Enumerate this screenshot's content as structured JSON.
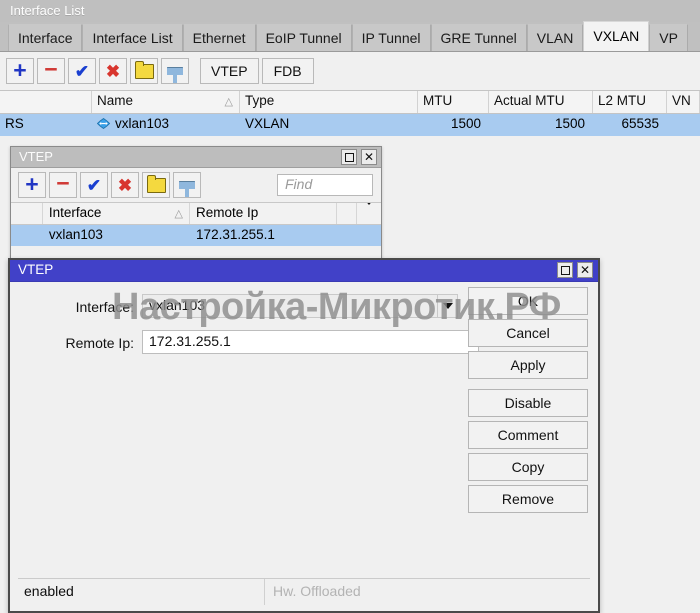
{
  "main_window": {
    "title": "Interface List",
    "tabs": [
      {
        "label": "Interface",
        "active": false
      },
      {
        "label": "Interface List",
        "active": false
      },
      {
        "label": "Ethernet",
        "active": false
      },
      {
        "label": "EoIP Tunnel",
        "active": false
      },
      {
        "label": "IP Tunnel",
        "active": false
      },
      {
        "label": "GRE Tunnel",
        "active": false
      },
      {
        "label": "VLAN",
        "active": false
      },
      {
        "label": "VXLAN",
        "active": true
      },
      {
        "label": "VP",
        "active": false
      }
    ],
    "toolbar": {
      "add_icon": "plus-icon",
      "remove_icon": "minus-icon",
      "enable_icon": "check-icon",
      "disable_icon": "cross-icon",
      "comment_icon": "folder-icon",
      "filter_icon": "filter-icon",
      "vtep_label": "VTEP",
      "fdb_label": "FDB"
    },
    "table": {
      "columns": [
        "",
        "Name",
        "Type",
        "MTU",
        "Actual MTU",
        "L2 MTU",
        "VN"
      ],
      "sort_indicator_column": "Name",
      "rows": [
        {
          "flags": "RS",
          "name": "vxlan103",
          "name_icon": "vxlan-interface-icon",
          "type": "VXLAN",
          "mtu": "1500",
          "actual_mtu": "1500",
          "l2_mtu": "65535",
          "vni": ""
        }
      ]
    }
  },
  "vtep_list_window": {
    "title": "VTEP",
    "maximize_icon": "maximize-icon",
    "close_icon": "close-icon",
    "toolbar": {
      "add_icon": "plus-icon",
      "remove_icon": "minus-icon",
      "enable_icon": "check-icon",
      "disable_icon": "cross-icon",
      "comment_icon": "folder-icon",
      "filter_icon": "filter-icon"
    },
    "find_placeholder": "Find",
    "find_value": "",
    "table": {
      "columns": [
        "",
        "Interface",
        "Remote Ip",
        "",
        ""
      ],
      "column_menu_icon": "chevron-down-icon",
      "rows": [
        {
          "flags": "",
          "interface": "vxlan103",
          "remote_ip": "172.31.255.1"
        }
      ]
    }
  },
  "vtep_dialog": {
    "title": "VTEP",
    "maximize_icon": "maximize-icon",
    "close_icon": "close-icon",
    "fields": {
      "interface_label": "Interface:",
      "interface_value": "vxlan103",
      "interface_dropdown_icon": "chevron-down-icon",
      "remote_ip_label": "Remote Ip:",
      "remote_ip_value": "172.31.255.1"
    },
    "buttons": [
      {
        "label": "OK"
      },
      {
        "label": "Cancel"
      },
      {
        "label": "Apply"
      },
      {
        "label": "Disable"
      },
      {
        "label": "Comment"
      },
      {
        "label": "Copy"
      },
      {
        "label": "Remove"
      }
    ],
    "status": {
      "state": "enabled",
      "hw_offload": "Hw. Offloaded"
    }
  },
  "watermark": {
    "text": "Настройка-Микротик.РФ"
  },
  "colors": {
    "selection_blue": "#a8cbf0",
    "dialog_title_blue": "#4141c8",
    "inactive_title_gray": "#bdbdbd",
    "window_bg": "#f0f0f0"
  }
}
